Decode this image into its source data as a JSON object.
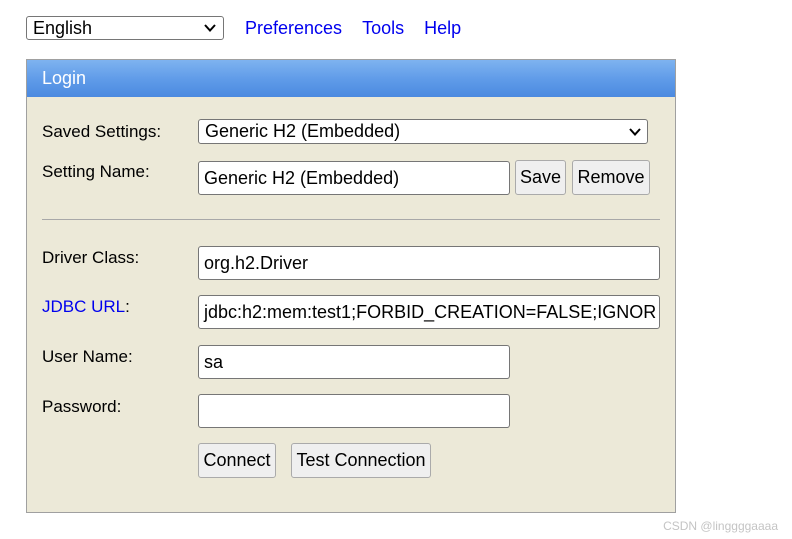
{
  "topbar": {
    "language": "English",
    "links": [
      "Preferences",
      "Tools",
      "Help"
    ]
  },
  "login": {
    "title": "Login",
    "saved_settings_label": "Saved Settings:",
    "saved_settings_value": "Generic H2 (Embedded)",
    "setting_name_label": "Setting Name:",
    "setting_name_value": "Generic H2 (Embedded)",
    "save_label": "Save",
    "remove_label": "Remove",
    "driver_class_label": "Driver Class:",
    "driver_class_value": "org.h2.Driver",
    "jdbc_url_link": "JDBC URL",
    "jdbc_url_colon": ":",
    "jdbc_url_value": "jdbc:h2:mem:test1;FORBID_CREATION=FALSE;IGNOR",
    "user_name_label": "User Name:",
    "user_name_value": "sa",
    "password_label": "Password:",
    "password_value": "",
    "connect_label": "Connect",
    "test_connection_label": "Test Connection"
  },
  "watermark": "CSDN @linggggaaaa",
  "colors": {
    "panel_bg": "#ece9d8",
    "header_gradient_top": "#7eb3f0",
    "header_gradient_bottom": "#4b8ae0",
    "link": "#0000ee"
  }
}
